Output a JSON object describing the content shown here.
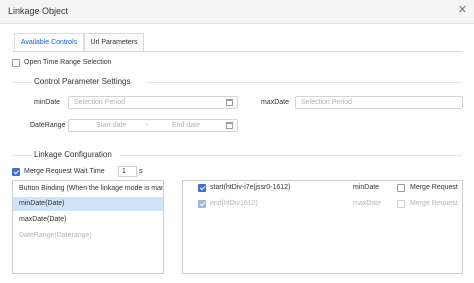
{
  "dialog": {
    "title": "Linkage Object",
    "close": "✕"
  },
  "tabs": [
    {
      "label": "Available Controls",
      "active": true
    },
    {
      "label": "Url Parameters",
      "active": false
    }
  ],
  "open_time_range": {
    "label": "Open Time Range Selection",
    "checked": false
  },
  "control_params": {
    "heading": "Control Parameter Settings",
    "min_date": {
      "label": "minDate",
      "placeholder": "Selection Period"
    },
    "max_date": {
      "label": "maxDate",
      "placeholder": "Selection Period"
    },
    "date_range": {
      "label": "DateRange",
      "start": "Start date",
      "sep": "~",
      "end": "End date"
    }
  },
  "linkage": {
    "heading": "Linkage Configuration",
    "wait": {
      "label": "Merge Request Wait Time",
      "checked": true,
      "value": "1",
      "unit": "s"
    },
    "left_list": [
      {
        "label": "Button Binding (When the linkage mode is manual)",
        "state": "normal"
      },
      {
        "label": "minDate(Date)",
        "state": "selected"
      },
      {
        "label": "maxDate(Date)",
        "state": "normal"
      },
      {
        "label": "DateRange(Daterange)",
        "state": "disabled"
      }
    ],
    "right_list": [
      {
        "label": "start(htDiv-i7e|jssr0-1612)",
        "param": "minDate",
        "checked": true,
        "disabled": false,
        "merge_label": "Merge Request",
        "merge_checked": false
      },
      {
        "label": "end(htDiv1612)",
        "param": "maxDate",
        "checked": true,
        "disabled": true,
        "merge_label": "Merge Request",
        "merge_checked": false
      }
    ]
  },
  "colors": {
    "accent": "#1e5fd6",
    "selected_row": "#cfe3fb",
    "check": "#3a6fd8"
  }
}
